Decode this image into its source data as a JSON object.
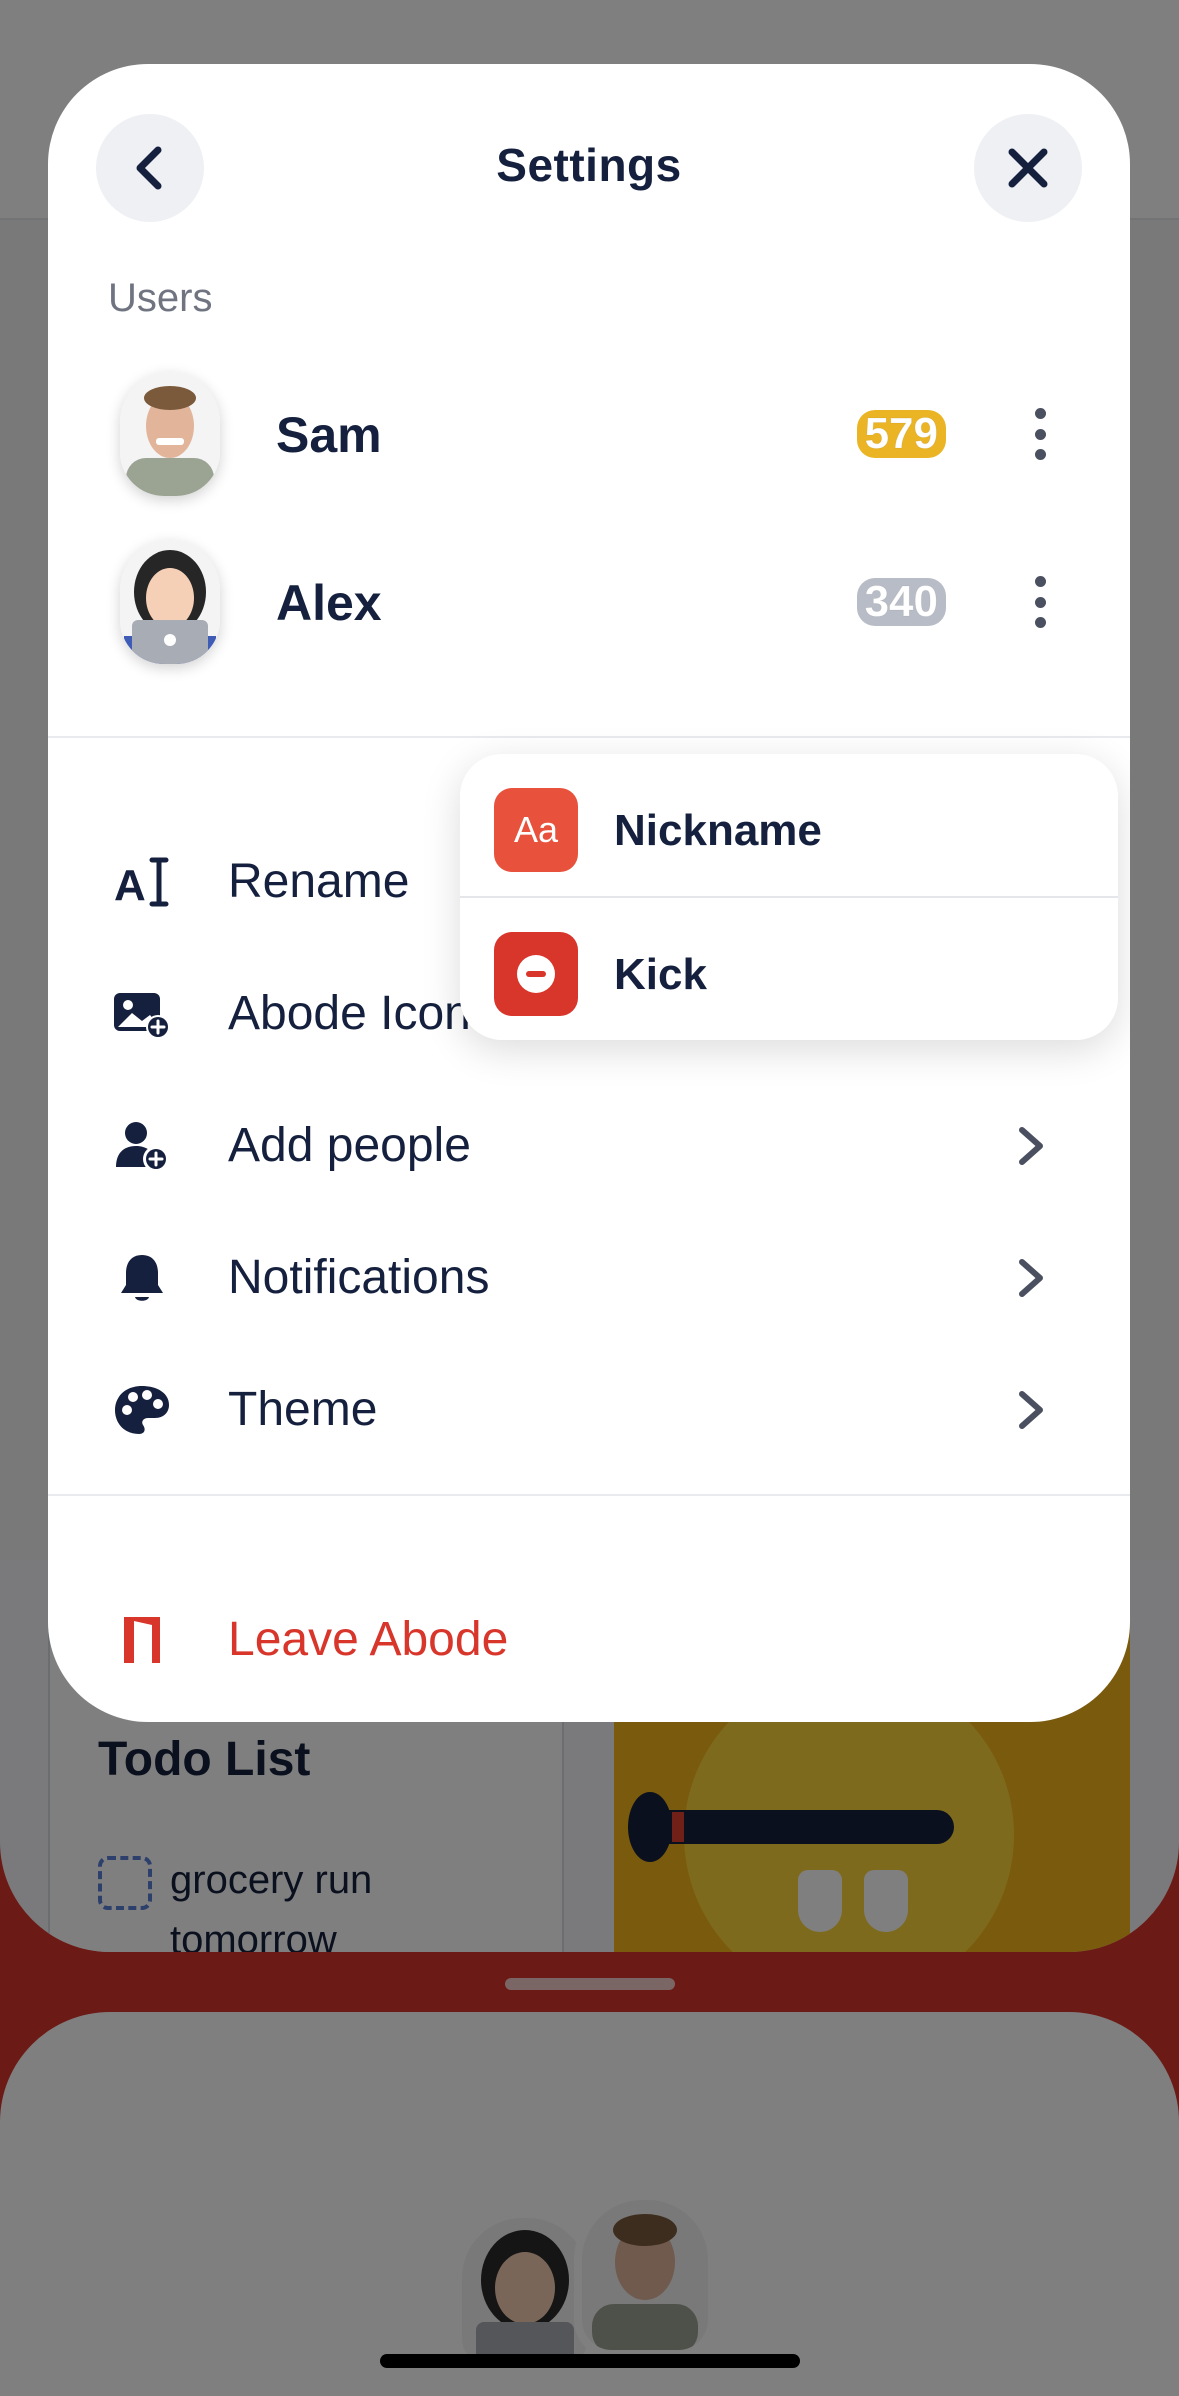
{
  "modal": {
    "title": "Settings",
    "back_icon": "chevron-left-icon",
    "close_icon": "close-icon"
  },
  "users_section": {
    "label": "Users",
    "users": [
      {
        "name": "Sam",
        "score": "579",
        "score_color": "#eab425",
        "avatar": "man-avatar"
      },
      {
        "name": "Alex",
        "score": "340",
        "score_color": "#b7bcc6",
        "avatar": "woman-laptop-avatar"
      }
    ]
  },
  "menu": {
    "items": [
      {
        "label": "Rename",
        "icon": "text-cursor-icon"
      },
      {
        "label": "Abode Icon",
        "icon": "image-add-icon"
      },
      {
        "label": "Add people",
        "icon": "person-add-icon"
      },
      {
        "label": "Notifications",
        "icon": "bell-icon"
      },
      {
        "label": "Theme",
        "icon": "palette-icon"
      }
    ],
    "leave_label": "Leave Abode",
    "leave_color": "#d8352b"
  },
  "popup": {
    "items": [
      {
        "label": "Nickname",
        "icon_text": "Aa",
        "icon_color": "#e8523d"
      },
      {
        "label": "Kick",
        "icon": "minus-circle-icon",
        "icon_color": "#d8352b"
      }
    ]
  },
  "background": {
    "todo_title": "Todo List",
    "todo_item": "grocery run tomorrow"
  }
}
